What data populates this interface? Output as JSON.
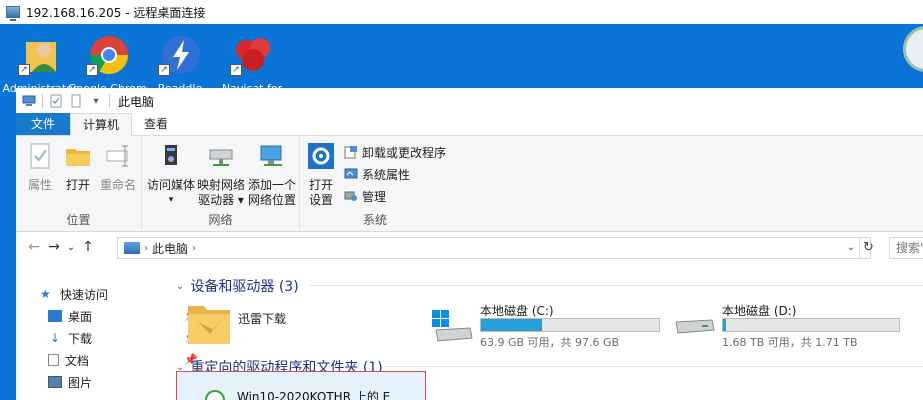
{
  "remote_window": {
    "title": "192.168.16.205 - 远程桌面连接"
  },
  "desktop": {
    "icons": [
      {
        "label": "Administrator",
        "icon": "user-folder-icon"
      },
      {
        "label": "Google Chrome",
        "icon": "chrome-icon"
      },
      {
        "label": "Readdle",
        "icon": "lightning-app-icon"
      },
      {
        "label": "Navicat for",
        "icon": "navicat-icon"
      }
    ]
  },
  "explorer": {
    "title": "此电脑",
    "tabs": [
      "文件",
      "计算机",
      "查看"
    ],
    "active_tab": "计算机",
    "ribbon": {
      "location_group": {
        "label": "位置",
        "buttons": [
          "属性",
          "打开",
          "重命名"
        ]
      },
      "network_group": {
        "label": "网络",
        "buttons": [
          {
            "line1": "访问媒体",
            "line2": "▾"
          },
          {
            "line1": "映射网络",
            "line2": "驱动器 ▾"
          },
          {
            "line1": "添加一个",
            "line2": "网络位置"
          }
        ]
      },
      "system_group": {
        "label": "系统",
        "open_settings": {
          "line1": "打开",
          "line2": "设置"
        },
        "small_buttons": [
          "卸载或更改程序",
          "系统属性",
          "管理"
        ]
      }
    },
    "address": {
      "crumb": "此电脑",
      "search_placeholder": "搜索\""
    },
    "nav_pane": {
      "items": [
        "快速访问",
        "桌面",
        "下载",
        "文档",
        "图片"
      ]
    },
    "sections": {
      "devices": {
        "title": "设备和驱动器 (3)",
        "items": [
          {
            "name": "迅雷下载",
            "type": "folder"
          },
          {
            "name": "本地磁盘 (C:)",
            "free_text": "63.9 GB 可用，共 97.6 GB",
            "used_fraction": 0.345
          },
          {
            "name": "本地磁盘 (D:)",
            "free_text": "1.68 TB 可用，共 1.71 TB",
            "used_fraction": 0.018
          }
        ]
      },
      "redirected": {
        "title": "重定向的驱动程序和文件夹 (1)",
        "items": [
          {
            "name": "Win10-2020KOTHR 上的 E"
          }
        ]
      }
    }
  }
}
